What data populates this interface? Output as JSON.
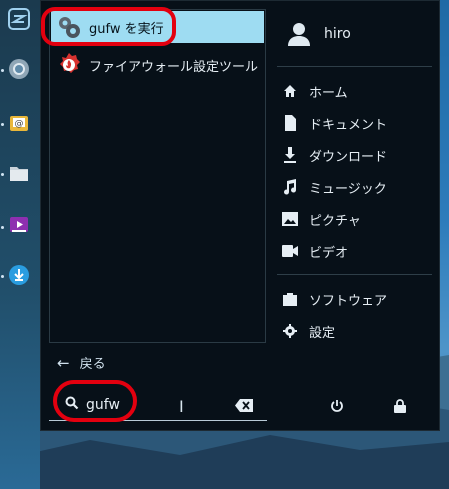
{
  "results": [
    {
      "label": "gufw を実行",
      "icon": "gears-icon",
      "selected": true
    },
    {
      "label": "ファイアウォール設定ツール",
      "icon": "firewall-icon",
      "selected": false
    }
  ],
  "back_label": "戻る",
  "search": {
    "value": "gufw"
  },
  "user": {
    "name": "hiro"
  },
  "places": [
    {
      "label": "ホーム",
      "icon": "home-icon"
    },
    {
      "label": "ドキュメント",
      "icon": "document-icon"
    },
    {
      "label": "ダウンロード",
      "icon": "download-icon"
    },
    {
      "label": "ミュージック",
      "icon": "music-icon"
    },
    {
      "label": "ピクチャ",
      "icon": "picture-icon"
    },
    {
      "label": "ビデオ",
      "icon": "video-icon"
    }
  ],
  "system": [
    {
      "label": "ソフトウェア",
      "icon": "software-icon"
    },
    {
      "label": "設定",
      "icon": "settings-icon"
    }
  ],
  "colors": {
    "selected": "#9edcf2",
    "annotation": "#e3000f",
    "menu_bg": "#071018"
  }
}
